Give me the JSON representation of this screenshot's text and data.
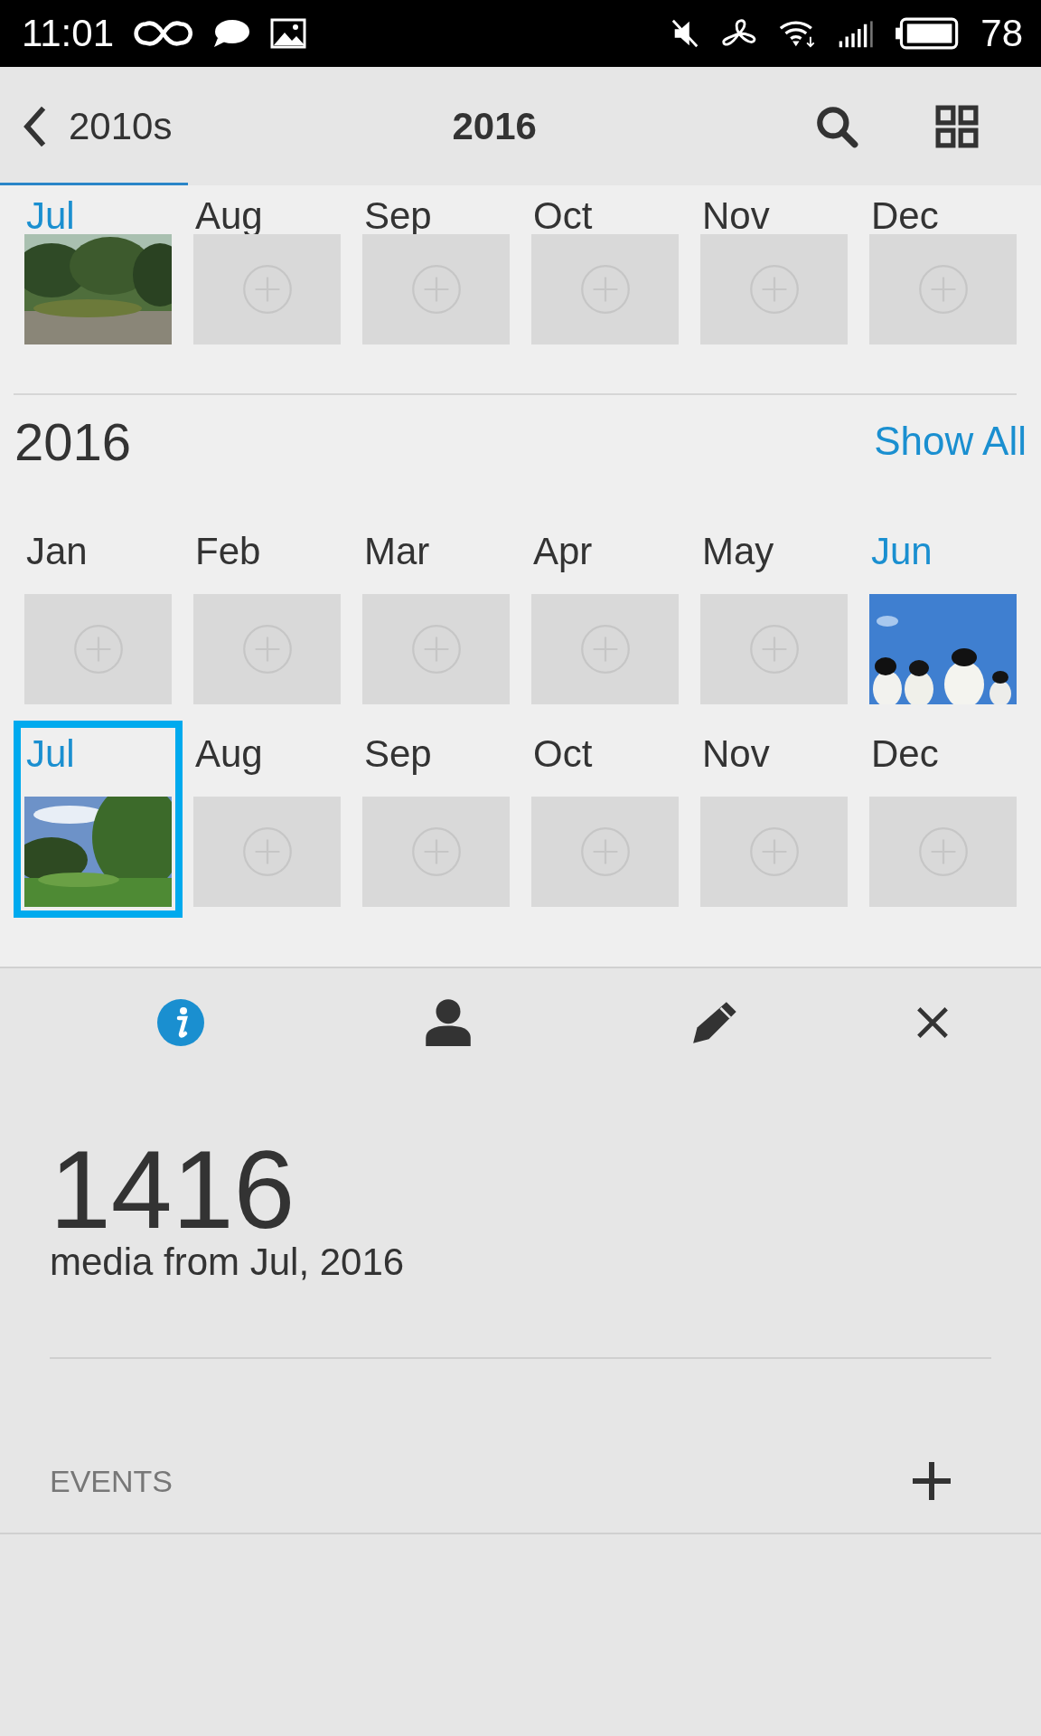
{
  "status_bar": {
    "time": "11:01",
    "battery": "78"
  },
  "header": {
    "back_label": "2010s",
    "title": "2016"
  },
  "previous_year": {
    "months": [
      {
        "label": "Jul",
        "has_photo": true,
        "selected": false
      },
      {
        "label": "Aug",
        "has_photo": false,
        "selected": false
      },
      {
        "label": "Sep",
        "has_photo": false,
        "selected": false
      },
      {
        "label": "Oct",
        "has_photo": false,
        "selected": false
      },
      {
        "label": "Nov",
        "has_photo": false,
        "selected": false
      },
      {
        "label": "Dec",
        "has_photo": false,
        "selected": false
      }
    ]
  },
  "year": {
    "title": "2016",
    "show_all": "Show All",
    "months": [
      {
        "label": "Jan",
        "has_photo": false,
        "selected": false
      },
      {
        "label": "Feb",
        "has_photo": false,
        "selected": false
      },
      {
        "label": "Mar",
        "has_photo": false,
        "selected": false
      },
      {
        "label": "Apr",
        "has_photo": false,
        "selected": false
      },
      {
        "label": "May",
        "has_photo": false,
        "selected": false
      },
      {
        "label": "Jun",
        "has_photo": true,
        "selected": false
      },
      {
        "label": "Jul",
        "has_photo": true,
        "selected": true
      },
      {
        "label": "Aug",
        "has_photo": false,
        "selected": false
      },
      {
        "label": "Sep",
        "has_photo": false,
        "selected": false
      },
      {
        "label": "Oct",
        "has_photo": false,
        "selected": false
      },
      {
        "label": "Nov",
        "has_photo": false,
        "selected": false
      },
      {
        "label": "Dec",
        "has_photo": false,
        "selected": false
      }
    ]
  },
  "details": {
    "tabs": [
      {
        "kind": "info",
        "selected": true
      },
      {
        "kind": "person",
        "selected": false
      },
      {
        "kind": "edit",
        "selected": false
      },
      {
        "kind": "close",
        "selected": false
      }
    ],
    "count": "1416",
    "caption": "media from Jul, 2016",
    "events_label": "EVENTS"
  }
}
